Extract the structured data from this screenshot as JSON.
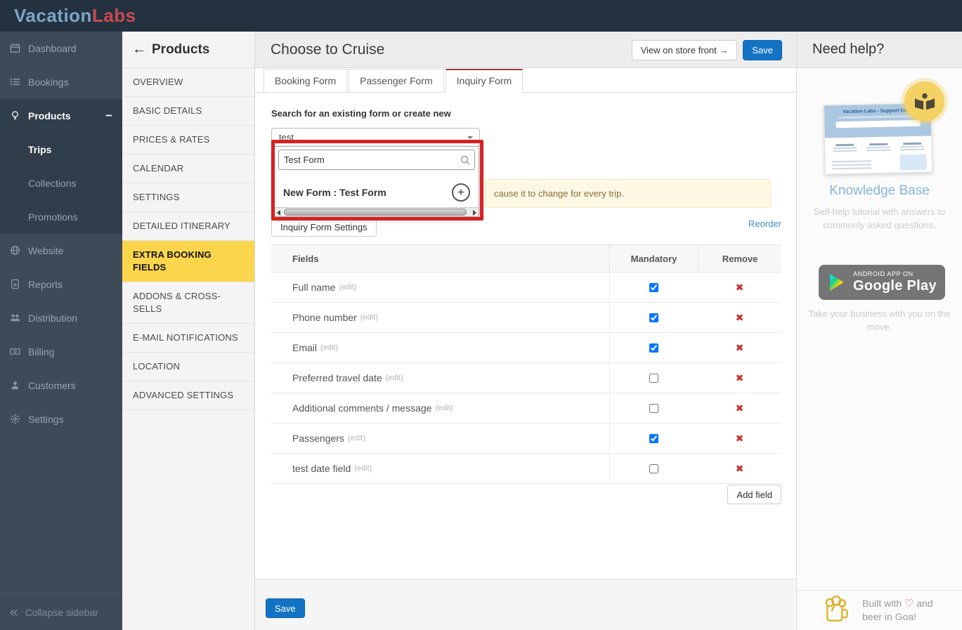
{
  "navbar": {
    "brand_primary": "Vacation",
    "brand_secondary": "Labs"
  },
  "sidebar": {
    "items": [
      {
        "label": "Dashboard",
        "icon": "calendar-icon"
      },
      {
        "label": "Bookings",
        "icon": "list-icon"
      },
      {
        "label": "Products",
        "icon": "bulb-icon",
        "dark": true,
        "bold": true,
        "collapse_glyph": "−"
      },
      {
        "label": "Trips",
        "dark": true,
        "sub": true,
        "bold": true
      },
      {
        "label": "Collections",
        "dark": true,
        "sub": true
      },
      {
        "label": "Promotions",
        "dark": true,
        "sub": true
      },
      {
        "label": "Website",
        "icon": "globe-icon"
      },
      {
        "label": "Reports",
        "icon": "report-icon"
      },
      {
        "label": "Distribution",
        "icon": "users-icon"
      },
      {
        "label": "Billing",
        "icon": "banknote-icon"
      },
      {
        "label": "Customers",
        "icon": "user-icon"
      },
      {
        "label": "Settings",
        "icon": "gear-icon"
      }
    ],
    "collapse_icon": "«",
    "collapse_label": "Collapse sidebar"
  },
  "product_menu": {
    "back_icon": "←",
    "title": "Products",
    "items": [
      "OVERVIEW",
      "BASIC DETAILS",
      "PRICES & RATES",
      "CALENDAR",
      "SETTINGS",
      "DETAILED ITINERARY",
      "EXTRA BOOKING FIELDS",
      "ADDONS & CROSS-SELLS",
      "E-MAIL NOTIFICATIONS",
      "LOCATION",
      "ADVANCED SETTINGS"
    ],
    "active_index": 6
  },
  "main": {
    "page_title": "Choose to Cruise",
    "view_store_button": "View on store front →",
    "save_button": "Save",
    "tabs": [
      "Booking Form",
      "Passenger Form",
      "Inquiry Form"
    ],
    "active_tab": "Inquiry Form",
    "search_label": "Search for an existing form or create new",
    "select_value": "test",
    "dropdown": {
      "search_value": "Test Form",
      "option_label": "New Form : Test Form",
      "add_glyph": "+"
    },
    "warning_text": "cause it to change for every trip.",
    "inquiry_settings_button": "Inquiry Form Settings",
    "reorder_link": "Reorder",
    "fields_table": {
      "headers": [
        "Fields",
        "Mandatory",
        "Remove"
      ],
      "edit_suffix": "(edit)",
      "remove_glyph": "✖",
      "rows": [
        {
          "label": "Full name",
          "mandatory": true
        },
        {
          "label": "Phone number",
          "mandatory": true
        },
        {
          "label": "Email",
          "mandatory": true
        },
        {
          "label": "Preferred travel date",
          "mandatory": false
        },
        {
          "label": "Additional comments / message",
          "mandatory": false
        },
        {
          "label": "Passengers",
          "mandatory": true
        },
        {
          "label": "test date field",
          "mandatory": false
        }
      ],
      "add_field_button": "Add field"
    },
    "footer_save_button": "Save"
  },
  "help_panel": {
    "title": "Need help?",
    "kb_thumb_title": "Vacation Labs - Support Desk",
    "kb_title": "Knowledge Base",
    "kb_subtitle": "Self-help tutorial with answers to commonly asked questions.",
    "play_badge_line1": "ANDROID APP ON",
    "play_badge_line2": "Google Play",
    "play_subtitle": "Take your business with you on the move.",
    "footer_text_1": "Built with",
    "heart": "♡",
    "footer_text_2": "and beer in Goa!"
  },
  "colors": {
    "navbar_bg": "#24313f",
    "sidebar_bg": "#3d4b59",
    "active_menu_yellow": "#fbd54b",
    "primary_blue": "#1273c4",
    "highlight_red_box": "#d92121",
    "remove_red": "#c9302c",
    "link_blue": "#3f8dc6",
    "warning_bg": "#fcf8e3",
    "tab_active_border": "#9d3c38"
  }
}
